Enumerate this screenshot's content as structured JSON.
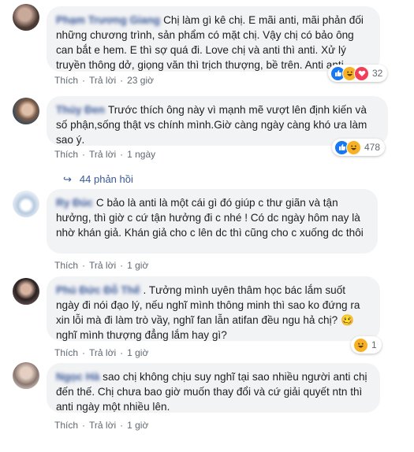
{
  "comments": [
    {
      "author": "Phạm Trương Giang",
      "text": "Chị làm gì kê chị. E mãi anti, mãi phản đối những chương trình, sản phẩm có mặt chị. Vậy chị có bảo ông can bắt e hem. E thì sợ quá đi. Love chị và anti thì anti. Xử lý truyền thông dở, giọng văn thì trịch thượng, bề trên. Anti anti.",
      "like": "Thích",
      "reply": "Trả lời",
      "time": "23 giờ",
      "reaction_count": "32",
      "reactions": [
        "like-icon",
        "haha-icon",
        "love-icon"
      ]
    },
    {
      "author": "Thúy Đen",
      "text": "Trước thích ông này vì mạnh mẽ vượt lên định kiến và số phận,sống thật vs chính mình.Giờ càng ngày càng khó ưa làm sao ý.",
      "like": "Thích",
      "reply": "Trả lời",
      "time": "1 ngày",
      "reaction_count": "478",
      "reactions": [
        "like-icon",
        "haha-icon"
      ],
      "replies": "44 phản hồi"
    },
    {
      "author": "Ry Đúc",
      "text": "C bảo là anti là một cái gì đó giúp c thư giãn và tận hưởng, thì giờ c cứ tận hưởng đi c nhé ! Có dc ngày hôm nay là nhờ khán giả. Khán giả cho c lên dc thì cũng cho c xuống dc thôi",
      "like": "Thích",
      "reply": "Trả lời",
      "time": "1 giờ"
    },
    {
      "author": "Phú Đức Đỗ Thế",
      "text": ". Tưởng mình uyên thâm học bác lắm suốt ngày đi nói đạo lý, nếu nghĩ mình thông minh thì sao ko đứng ra xin lỗi mà đi làm trò vầy, nghĩ fan lẫn atifan đều ngu hả chị? 🥴 nghĩ mình thượng đẳng lắm hay gì?",
      "like": "Thích",
      "reply": "Trả lời",
      "time": "1 giờ",
      "reaction_count": "1",
      "reactions": [
        "haha-icon"
      ]
    },
    {
      "author": "Ngọc Hà",
      "text": "sao chị không chịu suy nghĩ tại sao nhiều người anti chị đến thế. Chị chưa bao giờ muốn thay đổi và cứ giải quyết ntn thì anti ngày một nhiều lên.",
      "like": "Thích",
      "reply": "Trả lời",
      "time": "1 giờ"
    }
  ],
  "colors": {
    "bubble": "#f2f3f5",
    "link": "#385898",
    "meta": "#606770",
    "like_blue": "#1877f2",
    "haha_yellow": "#f7b125",
    "love_red": "#f33e58"
  }
}
